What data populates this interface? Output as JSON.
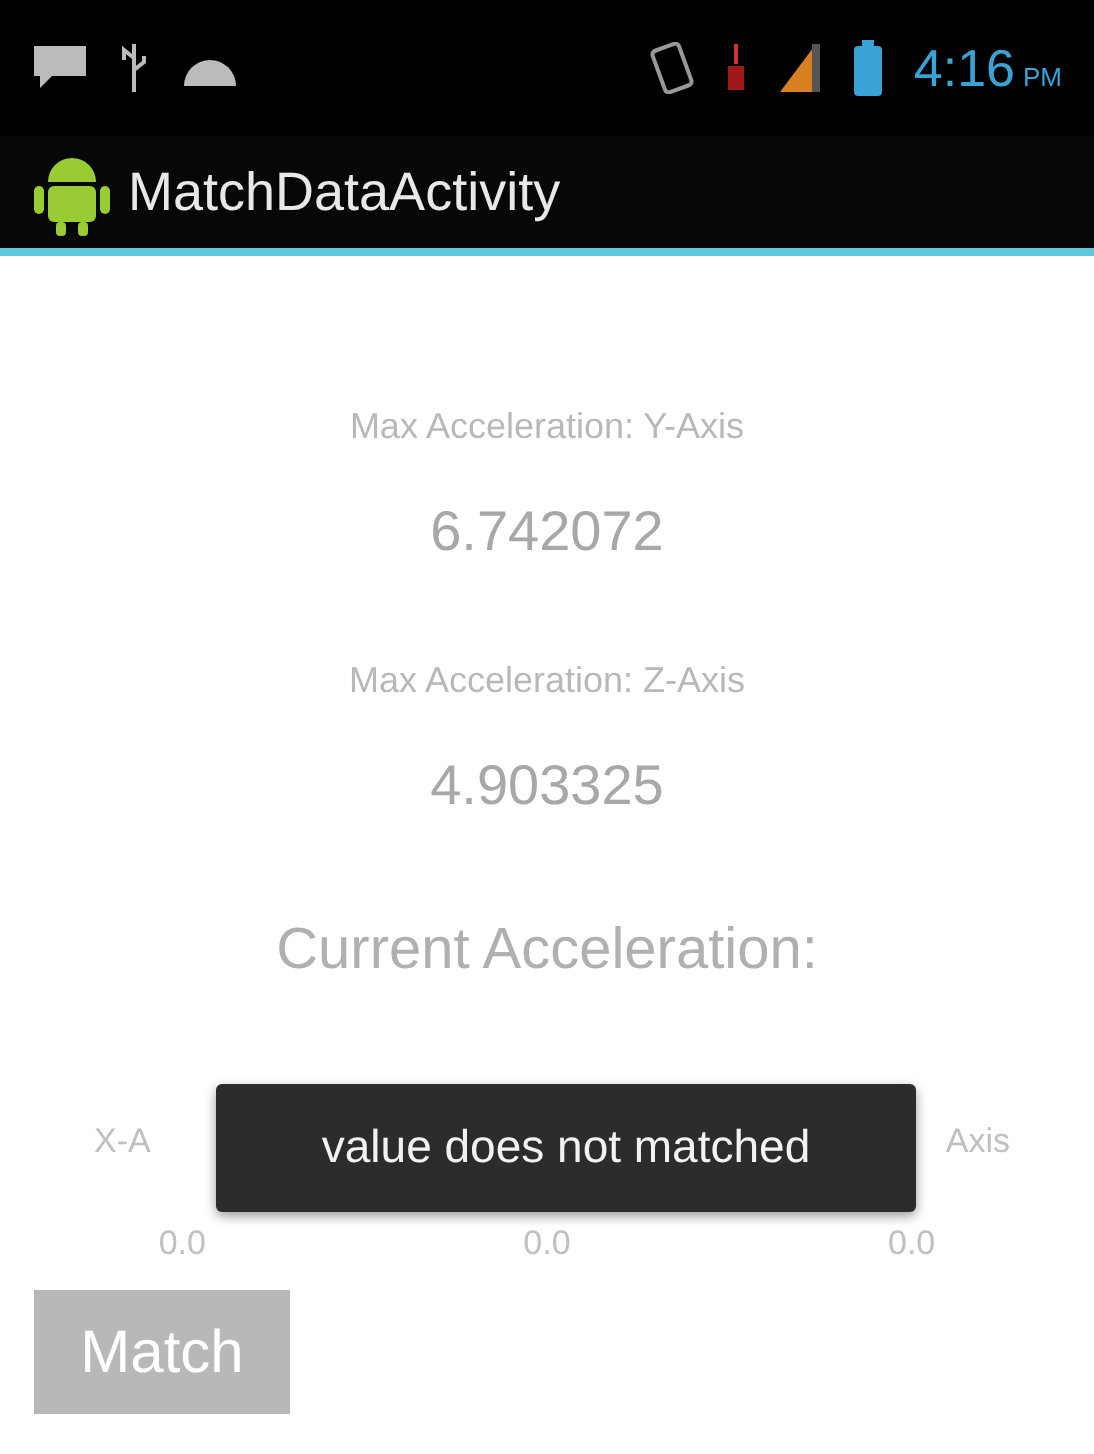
{
  "status_bar": {
    "time": "4:16",
    "meridiem": "PM"
  },
  "action_bar": {
    "title": "MatchDataActivity"
  },
  "max_readings": [
    {
      "label": "Max Acceleration: Y-Axis",
      "value": "6.742072"
    },
    {
      "label": "Max Acceleration: Z-Axis",
      "value": "4.903325"
    }
  ],
  "current": {
    "heading": "Current Acceleration:",
    "x_axis_label": "X-A",
    "z_axis_label": "Axis",
    "values": [
      "0.0",
      "0.0",
      "0.0"
    ]
  },
  "toast": {
    "message": "value does not matched"
  },
  "match_button": {
    "label": "Match",
    "disabled": true
  }
}
